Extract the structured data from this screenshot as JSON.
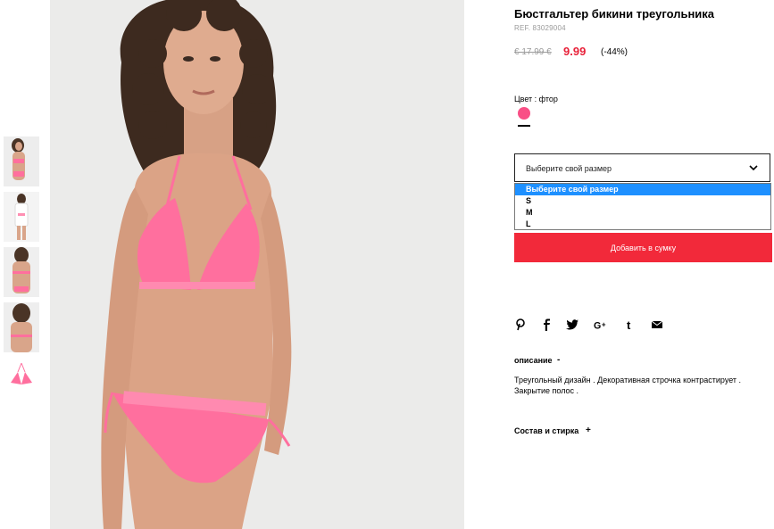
{
  "product": {
    "title": "Бюстгальтер бикини треугольника",
    "ref": "REF. 83029004",
    "old_price": "€ 17.99 €",
    "new_price": "9.99",
    "discount": "(-44%)"
  },
  "color": {
    "label": "Цвет : фтор",
    "swatch_color": "#f94f86"
  },
  "size_select": {
    "selected": "Выберите свой размер",
    "options": [
      "Выберите свой размер",
      "S",
      "M",
      "L"
    ]
  },
  "add_to_bag_label": "Добавить в сумку",
  "share_icons": [
    "pinterest-icon",
    "facebook-icon",
    "twitter-icon",
    "google-plus-icon",
    "tumblr-icon",
    "email-icon"
  ],
  "description": {
    "title": "описание",
    "toggle": "-",
    "text": "Треугольный дизайн . Декоративная строчка контрастирует . Закрытие полос ."
  },
  "care": {
    "title": "Состав и стирка",
    "toggle": "+"
  },
  "colors": {
    "accent": "#f2293a",
    "price": "#e8223a",
    "bikini": "#ff6f9e",
    "dropdown_highlight": "#1e90ff"
  }
}
